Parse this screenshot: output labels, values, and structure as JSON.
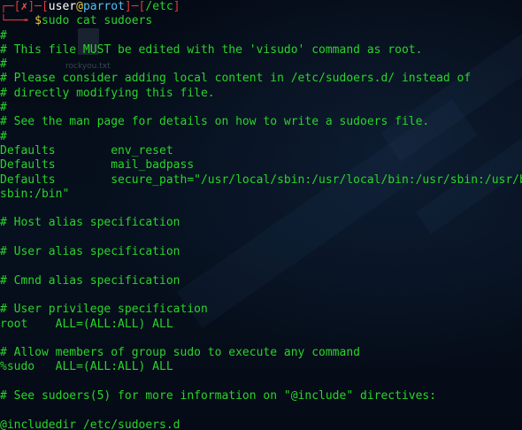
{
  "prompt": {
    "box_open": "┌─[",
    "status": "✗",
    "sep1": "]─[",
    "user": "user",
    "at": "@",
    "host": "parrot",
    "sep2": "]─[",
    "dir": "/etc",
    "box_close": "]",
    "arrow": "└──╼ ",
    "dollar": "$",
    "command": "sudo cat sudoers"
  },
  "desktop": {
    "file_label": "rockyou.txt"
  },
  "output": [
    "#",
    "# This file MUST be edited with the 'visudo' command as root.",
    "#",
    "# Please consider adding local content in /etc/sudoers.d/ instead of",
    "# directly modifying this file.",
    "#",
    "# See the man page for details on how to write a sudoers file.",
    "#",
    "Defaults        env_reset",
    "Defaults        mail_badpass",
    "Defaults        secure_path=\"/usr/local/sbin:/usr/local/bin:/usr/sbin:/usr/bin:/",
    "sbin:/bin\"",
    "",
    "# Host alias specification",
    "",
    "# User alias specification",
    "",
    "# Cmnd alias specification",
    "",
    "# User privilege specification",
    "root    ALL=(ALL:ALL) ALL",
    "",
    "# Allow members of group sudo to execute any command",
    "%sudo   ALL=(ALL:ALL) ALL",
    "",
    "# See sudoers(5) for more information on \"@include\" directives:",
    "",
    "@includedir /etc/sudoers.d"
  ],
  "colors": {
    "background": "#050b16",
    "text": "#2ad42a",
    "prompt_frame": "#e03838",
    "host": "#4fc3f7",
    "at": "#f0c93a"
  }
}
